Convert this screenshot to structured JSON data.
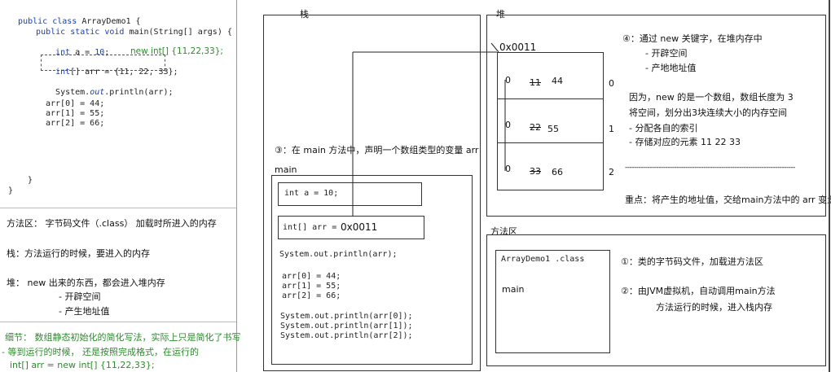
{
  "code": {
    "line1_kw": "public class",
    "line1_rest": "ArrayDemo1 {",
    "line2_kw": "public static void",
    "line2_rest": "main(String[] args) {",
    "line3_kw": "int",
    "line3_rest": "a = ",
    "line3_num": "10",
    "line3_end": ";",
    "annotation_new": "new int[] {11,22,33};",
    "line4_kw": "int",
    "line4_rest": "[] arr = {11, 22, 33};",
    "line5_a": "System.",
    "line5_it": "out",
    "line5_b": ".println(arr);",
    "line6": "arr[0] = 44;",
    "line7": "arr[1] = 55;",
    "line8": "arr[2] = 66;",
    "close_method": "}",
    "close_class": "}"
  },
  "notes": {
    "method_area": "方法区：  字节码文件（.class） 加载时所进入的内存",
    "stack": "栈：方法运行的时候，要进入的内存",
    "heap_title": "堆：  new 出来的东西，都会进入堆内存",
    "heap_item1": "- 开辟空间",
    "heap_item2": "- 产生地址值",
    "detail1": "细节：  数组静态初始化的简化写法，实际上只是简化了书写",
    "detail2": "- 等到运行的时候，  还是按照完成格式，在运行的",
    "detail3": "int[] arr = new int[] {11,22,33};"
  },
  "stack_panel": {
    "title": "栈",
    "step3": "③：在 main 方法中，声明一个数组类型的变量 arr",
    "main_label": "main",
    "cell_a": "int a = 10;",
    "cell_arr_code": "int[] arr = ",
    "cell_arr_addr": "0x0011",
    "println_arr": "System.out.println(arr);",
    "assign0": "arr[0] = 44;",
    "assign1": "arr[1] = 55;",
    "assign2": "arr[2] = 66;",
    "print0": "System.out.println(arr[0]);",
    "print1": "System.out.println(arr[1]);",
    "print2": "System.out.println(arr[2]);"
  },
  "heap_panel": {
    "title": "堆",
    "address": "0x0011",
    "cells": [
      {
        "zero": "0",
        "old": "11",
        "new": "44",
        "index": "0"
      },
      {
        "zero": "0",
        "old": "22",
        "new": "55",
        "index": "1"
      },
      {
        "zero": "0",
        "old": "33",
        "new": "66",
        "index": "2"
      }
    ],
    "step4_title": "④：通过 new 关键字，在堆内存中",
    "step4_item1": "- 开辟空间",
    "step4_item2": "- 产地地址值",
    "explain1": "因为，new 的是一个数组，数组长度为 3",
    "explain2": "将空间，划分出3块连续大小的内存空间",
    "explain3": "- 分配各自的索引",
    "explain4": "- 存储对应的元素  11  22  33",
    "dashes": "----------------------------------------------------------------------------",
    "key_point": "重点：将产生的地址值，交给main方法中的 arr 变量"
  },
  "method_panel": {
    "title": "方法区",
    "class_label": "ArrayDemo1 .class",
    "main_label": "main",
    "step1": "①：类的字节码文件，加载进方法区",
    "step2": "②：由JVM虚拟机，自动调用main方法",
    "step2b": "方法运行的时候，进入栈内存"
  },
  "colors": {
    "keyword": "#1a3fa8",
    "green_note": "#2d8a2d",
    "border": "#333333"
  }
}
